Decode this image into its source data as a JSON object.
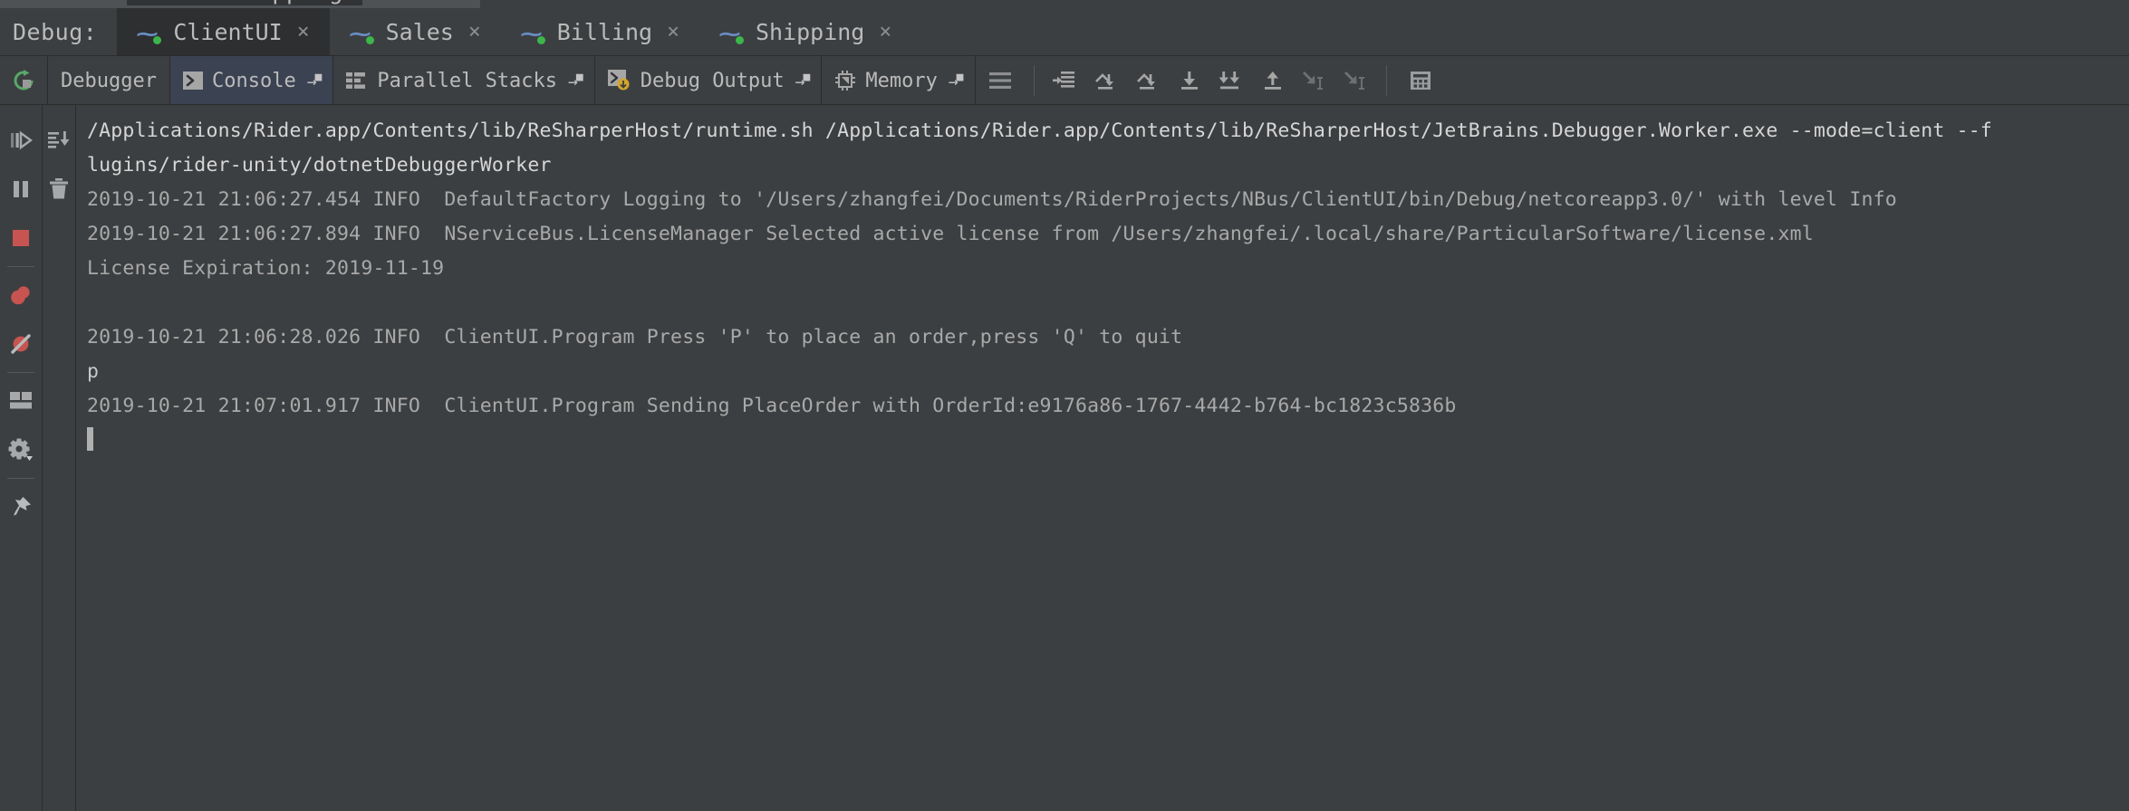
{
  "window": {
    "partial_top_tab": "Shipping"
  },
  "session_bar": {
    "label": "Debug:",
    "tabs": [
      {
        "name": "ClientUI",
        "active": true,
        "icon": "nservicebus-icon",
        "close": "×",
        "running": true
      },
      {
        "name": "Sales",
        "active": false,
        "icon": "nservicebus-icon",
        "close": "×",
        "running": true
      },
      {
        "name": "Billing",
        "active": false,
        "icon": "nservicebus-icon",
        "close": "×",
        "running": true
      },
      {
        "name": "Shipping",
        "active": false,
        "icon": "nservicebus-icon",
        "close": "×",
        "running": true
      }
    ]
  },
  "toolbar": {
    "rerun_title": "Rerun",
    "tabs": [
      {
        "label": "Debugger",
        "selected": false,
        "icon": "none",
        "detachable": false
      },
      {
        "label": "Console",
        "selected": true,
        "icon": "console-icon",
        "detachable": true
      },
      {
        "label": "Parallel Stacks",
        "selected": false,
        "icon": "stacks-icon",
        "detachable": true
      },
      {
        "label": "Debug Output",
        "selected": false,
        "icon": "debug-out-icon",
        "detachable": true
      },
      {
        "label": "Memory",
        "selected": false,
        "icon": "memory-icon",
        "detachable": true
      }
    ],
    "detach_glyph": "→",
    "actions": [
      {
        "name": "show-frames-icon"
      },
      {
        "name": "step-over-icon"
      },
      {
        "name": "step-out-icon"
      },
      {
        "name": "force-step-over-icon"
      },
      {
        "name": "step-into-icon"
      },
      {
        "name": "force-step-into-icon"
      },
      {
        "name": "step-out-up-icon"
      },
      {
        "name": "run-to-cursor-icon"
      },
      {
        "name": "force-run-to-cursor-icon"
      },
      {
        "name": "evaluate-expression-icon"
      }
    ]
  },
  "sidebar": {
    "items": [
      {
        "name": "resume-program-button",
        "icon": "resume-icon",
        "enabled": false
      },
      {
        "name": "pause-program-button",
        "icon": "pause-icon",
        "enabled": true
      },
      {
        "name": "stop-program-button",
        "icon": "stop-icon",
        "enabled": true
      },
      {
        "name": "view-breakpoints-button",
        "icon": "breakpoints-icon",
        "enabled": true
      },
      {
        "name": "mute-breakpoints-button",
        "icon": "mute-breakpoints-icon",
        "enabled": true
      },
      {
        "name": "restore-layout-button",
        "icon": "layout-icon",
        "enabled": true
      },
      {
        "name": "settings-button",
        "icon": "gear-icon",
        "enabled": true
      },
      {
        "name": "pin-tab-button",
        "icon": "pin-icon",
        "enabled": true
      }
    ]
  },
  "console_sidebar": {
    "items": [
      {
        "name": "scroll-to-end-button",
        "icon": "scroll-to-end-icon"
      },
      {
        "name": "clear-all-button",
        "icon": "trash-icon"
      }
    ]
  },
  "console": {
    "lines": [
      {
        "kind": "cmd",
        "text": "/Applications/Rider.app/Contents/lib/ReSharperHost/runtime.sh /Applications/Rider.app/Contents/lib/ReSharperHost/JetBrains.Debugger.Worker.exe --mode=client --f"
      },
      {
        "kind": "cmd",
        "text": "lugins/rider-unity/dotnetDebuggerWorker"
      },
      {
        "kind": "log",
        "text": "2019-10-21 21:06:27.454 INFO  DefaultFactory Logging to '/Users/zhangfei/Documents/RiderProjects/NBus/ClientUI/bin/Debug/netcoreapp3.0/' with level Info"
      },
      {
        "kind": "log",
        "text": "2019-10-21 21:06:27.894 INFO  NServiceBus.LicenseManager Selected active license from /Users/zhangfei/.local/share/ParticularSoftware/license.xml"
      },
      {
        "kind": "log",
        "text": "License Expiration: 2019-11-19"
      },
      {
        "kind": "blank",
        "text": " "
      },
      {
        "kind": "log",
        "text": "2019-10-21 21:06:28.026 INFO  ClientUI.Program Press 'P' to place an order,press 'Q' to quit"
      },
      {
        "kind": "user",
        "text": "p"
      },
      {
        "kind": "log",
        "text": "2019-10-21 21:07:01.917 INFO  ClientUI.Program Sending PlaceOrder with OrderId:e9176a86-1767-4442-b764-bc1823c5836b"
      },
      {
        "kind": "caret",
        "text": ""
      }
    ]
  },
  "colors": {
    "background": "#3c3f41",
    "active_tab": "#2d2f31",
    "selected_tab": "#3b4252",
    "text": "#bbbbbb",
    "log_text": "#a9a9a9",
    "command_text": "#d6d6d6",
    "running_dot": "#3cb54a",
    "stop_red": "#c75450",
    "resume_green": "#59a869"
  }
}
